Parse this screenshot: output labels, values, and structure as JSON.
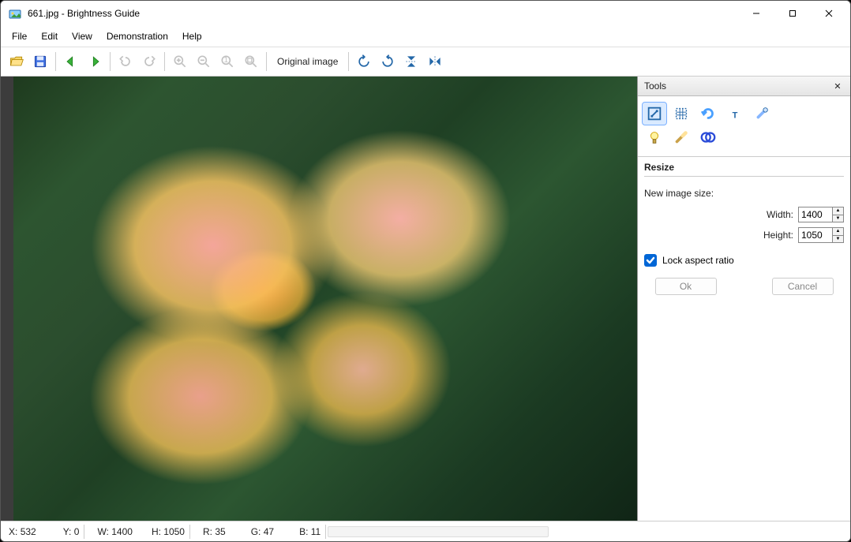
{
  "window": {
    "title": "661.jpg - Brightness Guide"
  },
  "menu": {
    "file": "File",
    "edit": "Edit",
    "view": "View",
    "demonstration": "Demonstration",
    "help": "Help"
  },
  "toolbar": {
    "original_image": "Original image"
  },
  "panel": {
    "title": "Tools",
    "section": "Resize",
    "new_size_label": "New image size:",
    "width_label": "Width:",
    "height_label": "Height:",
    "width_value": "1400",
    "height_value": "1050",
    "lock_label": "Lock aspect ratio",
    "ok": "Ok",
    "cancel": "Cancel"
  },
  "status": {
    "x_label": "X:",
    "x": "532",
    "y_label": "Y:",
    "y": "0",
    "w_label": "W:",
    "w": "1400",
    "h_label": "H:",
    "h": "1050",
    "r_label": "R:",
    "r": "35",
    "g_label": "G:",
    "g": "47",
    "b_label": "B:",
    "b": "11"
  }
}
